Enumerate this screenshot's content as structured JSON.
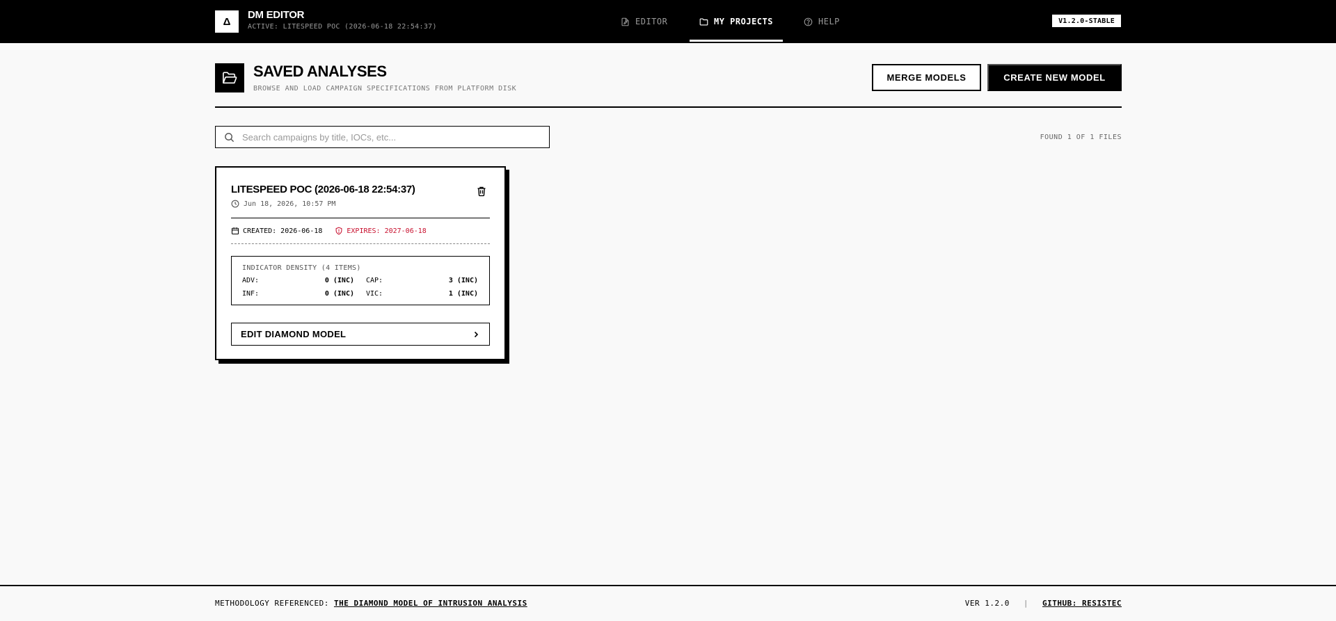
{
  "app": {
    "logo_glyph": "Δ",
    "title": "DM EDITOR",
    "active_label": "ACTIVE: LITESPEED POC (2026-06-18 22:54:37)",
    "version_badge": "V1.2.0-STABLE"
  },
  "nav": {
    "editor": "EDITOR",
    "my_projects": "MY PROJECTS",
    "help": "HELP",
    "active_tab": "my_projects"
  },
  "header": {
    "title": "SAVED ANALYSES",
    "subtitle": "BROWSE AND LOAD CAMPAIGN SPECIFICATIONS FROM PLATFORM DISK",
    "merge_label": "MERGE MODELS",
    "create_label": "CREATE NEW MODEL"
  },
  "search": {
    "placeholder": "Search campaigns by title, IOCs, etc...",
    "value": "",
    "found_text": "FOUND 1 OF 1 FILES"
  },
  "projects": [
    {
      "title": "LITESPEED POC (2026-06-18 22:54:37)",
      "modified": "Jun 18, 2026, 10:57 PM",
      "created": "CREATED: 2026-06-18",
      "expires": "EXPIRES: 2027-06-18",
      "density_title": "INDICATOR DENSITY (4 ITEMS)",
      "density": {
        "adv_label": "ADV:",
        "adv_value": "0 (INC)",
        "cap_label": "CAP:",
        "cap_value": "3 (INC)",
        "inf_label": "INF:",
        "inf_value": "0 (INC)",
        "vic_label": "VIC:",
        "vic_value": "1 (INC)"
      },
      "edit_label": "EDIT DIAMOND MODEL"
    }
  ],
  "footer": {
    "methodology_prefix": "METHODOLOGY REFERENCED:",
    "methodology_link": "THE DIAMOND MODEL OF INTRUSION ANALYSIS",
    "version": "VER 1.2.0",
    "separator": "|",
    "github_link": "GITHUB: RESISTEC"
  },
  "colors": {
    "topbar": "#000000",
    "background": "#f9f9f9",
    "expires": "#c8102e"
  }
}
